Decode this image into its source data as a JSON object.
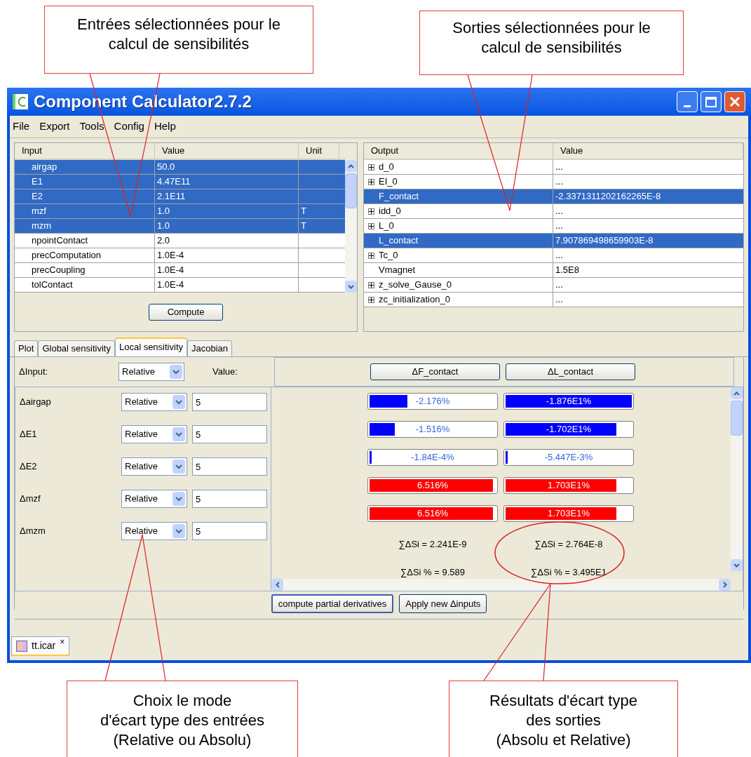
{
  "annotations_top": [
    {
      "lines": [
        "Entrées sélectionnées pour le",
        "calcul de sensibilités"
      ]
    },
    {
      "lines": [
        "Sorties sélectionnées pour le",
        "calcul de sensibilités"
      ]
    }
  ],
  "window": {
    "title": "Component Calculator2.7.2"
  },
  "menu": [
    "File",
    "Export",
    "Tools",
    "Config",
    "Help"
  ],
  "inputs": {
    "columns": [
      "Input",
      "Value",
      "Unit"
    ],
    "rows": [
      {
        "name": "airgap",
        "value": "50.0",
        "selected": true
      },
      {
        "name": "E1",
        "value": "4.47E11",
        "selected": true
      },
      {
        "name": "E2",
        "value": "2.1E11",
        "selected": true
      },
      {
        "name": "mzf",
        "value": "1.0",
        "unit": "T",
        "selected": true
      },
      {
        "name": "mzm",
        "value": "1.0",
        "unit": "T",
        "selected": true
      },
      {
        "name": "npointContact",
        "value": "2.0",
        "selected": false
      },
      {
        "name": "precComputation",
        "value": "1.0E-4",
        "selected": false
      },
      {
        "name": "precCoupling",
        "value": "1.0E-4",
        "selected": false
      },
      {
        "name": "tolContact",
        "value": "1.0E-4",
        "selected": false
      }
    ]
  },
  "compute_button": "Compute",
  "outputs": {
    "columns": [
      "Output",
      "Value"
    ],
    "rows": [
      {
        "name": "d_0",
        "value": "...",
        "expandable": true,
        "selected": false
      },
      {
        "name": "EI_0",
        "value": "...",
        "expandable": true,
        "selected": false
      },
      {
        "name": "F_contact",
        "value": "-2.3371311202162265E-8",
        "expandable": false,
        "selected": true
      },
      {
        "name": "idd_0",
        "value": "...",
        "expandable": true,
        "selected": false
      },
      {
        "name": "L_0",
        "value": "...",
        "expandable": true,
        "selected": false
      },
      {
        "name": "L_contact",
        "value": "7.907869498659903E-8",
        "expandable": false,
        "selected": true
      },
      {
        "name": "Tc_0",
        "value": "...",
        "expandable": true,
        "selected": false
      },
      {
        "name": "Vmagnet",
        "value": "1.5E8",
        "expandable": false,
        "selected": false
      },
      {
        "name": "z_solve_Gause_0",
        "value": "...",
        "expandable": true,
        "selected": false
      },
      {
        "name": "zc_initialization_0",
        "value": "...",
        "expandable": true,
        "selected": false
      }
    ]
  },
  "tabs": [
    {
      "label": "Plot",
      "selected": false
    },
    {
      "label": "Global sensitivity",
      "selected": false
    },
    {
      "label": "Local sensitivity",
      "selected": true
    },
    {
      "label": "Jacobian",
      "selected": false
    }
  ],
  "local_sensitivity": {
    "delta_input_label": "ΔInput:",
    "delta_input_mode": "Relative",
    "value_label": "Value:",
    "output_buttons": [
      "ΔF_contact",
      "ΔL_contact"
    ],
    "inputs": [
      {
        "label": "Δairgap",
        "mode": "Relative",
        "value": "5"
      },
      {
        "label": "ΔE1",
        "mode": "Relative",
        "value": "5"
      },
      {
        "label": "ΔE2",
        "mode": "Relative",
        "value": "5"
      },
      {
        "label": "Δmzf",
        "mode": "Relative",
        "value": "5"
      },
      {
        "label": "Δmzm",
        "mode": "Relative",
        "value": "5"
      }
    ],
    "results": [
      [
        {
          "text": "-2.176%",
          "level": 0.3,
          "color": "#0000ff"
        },
        {
          "text": "-1.876E1%",
          "level": 1,
          "color": "#0000ff"
        }
      ],
      [
        {
          "text": "-1.516%",
          "level": 0.2,
          "color": "#0000ff"
        },
        {
          "text": "-1.702E1%",
          "level": 0.88,
          "color": "#0000ff"
        }
      ],
      [
        {
          "text": "-1.84E-4%",
          "level": 0.01,
          "color": "#0000ff"
        },
        {
          "text": "-5.447E-3%",
          "level": 0.01,
          "color": "#0000ff"
        }
      ],
      [
        {
          "text": "6.516%",
          "level": 0.98,
          "color": "#ff0000"
        },
        {
          "text": "1.703E1%",
          "level": 0.88,
          "color": "#ff0000"
        }
      ],
      [
        {
          "text": "6.516%",
          "level": 0.98,
          "color": "#ff0000"
        },
        {
          "text": "1.703E1%",
          "level": 0.88,
          "color": "#ff0000"
        }
      ]
    ],
    "sums": [
      [
        "∑ΔSi = 2.241E-9",
        "∑ΔSi = 2.764E-8"
      ],
      [
        "∑ΔSi % = 9.589",
        "∑ΔSi % = 3.495E1"
      ]
    ]
  },
  "buttons": [
    "compute partial derivatives",
    "Apply new Δinputs"
  ],
  "document_tab": {
    "label": "tt.icar",
    "close": "×"
  },
  "annotations_bottom": [
    {
      "lines": [
        "Choix le mode",
        "d'écart type des entrées",
        "(Relative ou Absolu)"
      ]
    },
    {
      "lines": [
        "Résultats d'écart type",
        "des sorties",
        "(Absolu et Relative)"
      ]
    }
  ]
}
